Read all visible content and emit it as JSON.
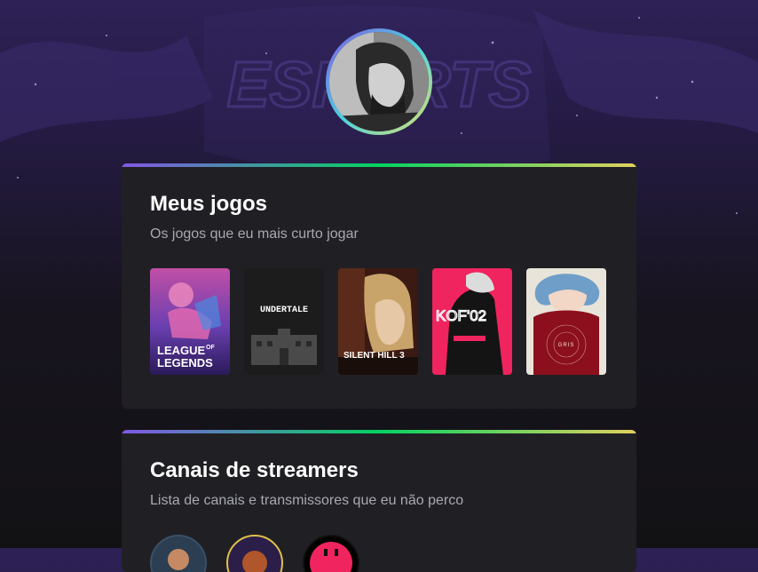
{
  "profile": {
    "avatar_alt": "Foto de perfil"
  },
  "background": {
    "logo_text": "ESPORTS"
  },
  "games_section": {
    "title": "Meus jogos",
    "subtitle": "Os jogos que eu mais curto jogar",
    "games": [
      {
        "name": "League of Legends",
        "cover_text": [
          "LEAGUE",
          "OF",
          "LEGENDS"
        ]
      },
      {
        "name": "Undertale",
        "cover_text": [
          "UNDERTALE"
        ]
      },
      {
        "name": "Silent Hill 3",
        "cover_text": [
          "SILENT HILL 3"
        ]
      },
      {
        "name": "KOF 02",
        "cover_text": [
          "KOF'02"
        ]
      },
      {
        "name": "Gris",
        "cover_text": [
          "GRIS"
        ]
      }
    ]
  },
  "streamers_section": {
    "title": "Canais de streamers",
    "subtitle": "Lista de canais e transmissores que eu não perco"
  },
  "colors": {
    "card_bg": "#202024",
    "accent_gradient": [
      "#8257e5",
      "#04d361",
      "#e1d15f"
    ],
    "title": "#ffffff",
    "subtitle": "#a8a8b3"
  }
}
